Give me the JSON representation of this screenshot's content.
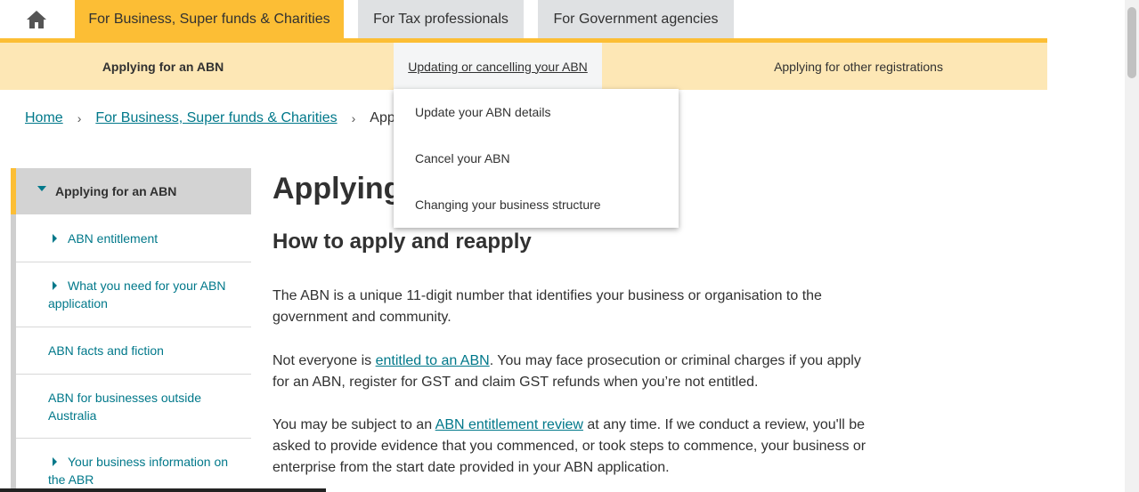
{
  "top_tabs": {
    "home_icon": "home-icon",
    "business": "For Business, Super funds & Charities",
    "tax": "For Tax professionals",
    "government": "For Government agencies"
  },
  "sub_nav": {
    "applying": "Applying for an ABN",
    "updating": "Updating or cancelling your ABN",
    "other": "Applying for other registrations"
  },
  "dropdown": {
    "items": [
      "Update your ABN details",
      "Cancel your ABN",
      "Changing your business structure"
    ]
  },
  "breadcrumb": {
    "home": "Home",
    "business": "For Business, Super funds & Charities",
    "separator": "›",
    "current": "Applying for an ABN"
  },
  "sidebar": {
    "heading": "Applying for an ABN",
    "items": [
      "ABN entitlement",
      "What you need for your ABN application",
      "ABN facts and fiction",
      "ABN for businesses outside Australia",
      "Your business information on the ABR"
    ]
  },
  "main": {
    "title": "Applying for an ABN",
    "heading": "How to apply and reapply",
    "p1": "The ABN is a unique 11-digit number that identifies your business or organisation to the government and community.",
    "p2_before": "Not everyone is ",
    "p2_link": "entitled to an ABN",
    "p2_after": ". You may face prosecution or criminal charges if you apply for an ABN, register for GST and claim GST refunds when you’re not entitled.",
    "p3_before": "You may be subject to an ",
    "p3_link": "ABN entitlement review",
    "p3_after": " at any time. If we conduct a review, you'll be asked to provide evidence that you commenced, or took steps to commence, your business or enterprise from the start date provided in your ABN application."
  },
  "colors": {
    "accent_yellow": "#fcbe35",
    "subnav_bg": "#fde7b5",
    "link_teal": "#00788a"
  }
}
